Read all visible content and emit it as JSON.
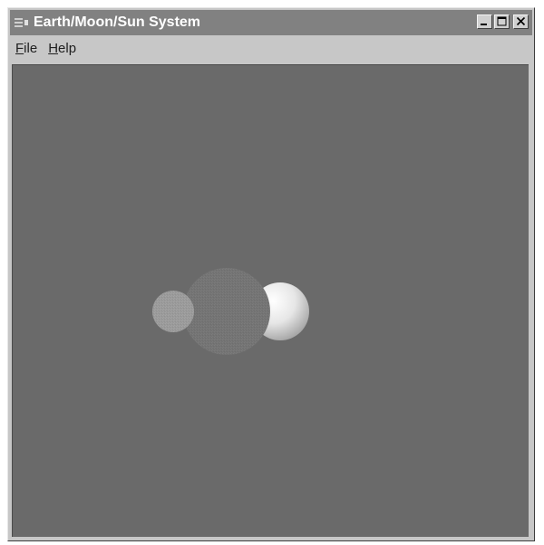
{
  "window": {
    "title": "Earth/Moon/Sun System"
  },
  "menu": {
    "file_accel": "F",
    "file_rest": "ile",
    "help_accel": "H",
    "help_rest": "elp"
  },
  "scene": {
    "background_color": "#6a6a6a",
    "bodies": [
      {
        "name": "sun",
        "color": "#f0f0f0"
      },
      {
        "name": "earth",
        "color": "#747474"
      },
      {
        "name": "moon",
        "color": "#9a9a9a"
      }
    ]
  }
}
